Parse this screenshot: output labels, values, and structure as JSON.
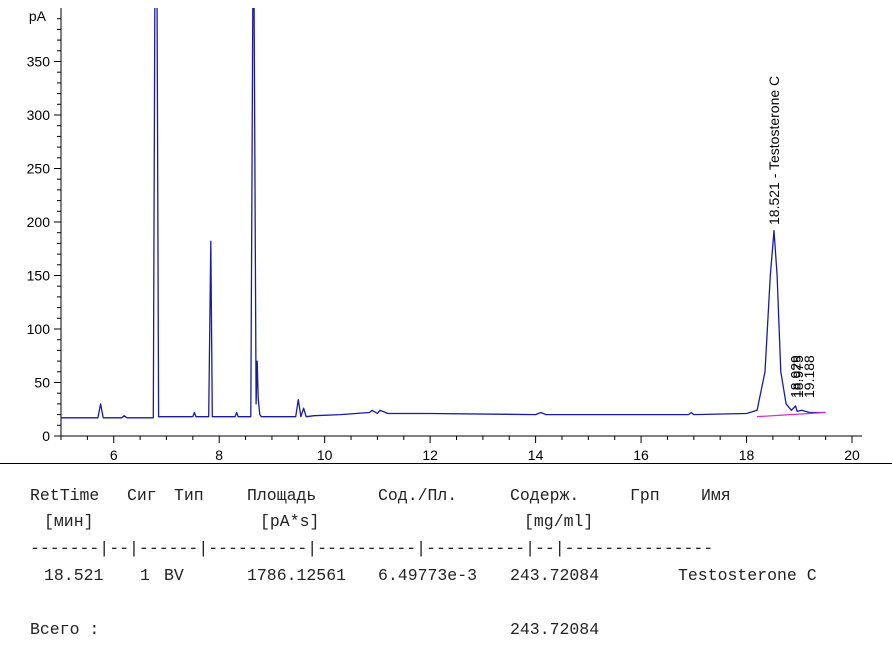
{
  "chart_data": {
    "type": "line",
    "y_unit": "pA",
    "xlim": [
      5,
      20
    ],
    "ylim": [
      0,
      400
    ],
    "x_ticks": [
      6,
      8,
      10,
      12,
      14,
      16,
      18,
      20
    ],
    "y_ticks": [
      0,
      50,
      100,
      150,
      200,
      250,
      300,
      350
    ],
    "series": [
      {
        "color": "#1a1aa8",
        "x": [
          5.0,
          5.7,
          5.75,
          5.8,
          6.15,
          6.2,
          6.25,
          6.75,
          6.78,
          6.8,
          6.82,
          6.85,
          7.5,
          7.53,
          7.56,
          7.8,
          7.84,
          7.87,
          8.3,
          8.33,
          8.36,
          8.6,
          8.64,
          8.66,
          8.7,
          8.72,
          8.74,
          8.77,
          8.8,
          9.45,
          9.5,
          9.55,
          9.6,
          9.65,
          9.8,
          10.3,
          10.85,
          10.9,
          11.0,
          11.05,
          11.2,
          12.0,
          14.0,
          14.1,
          14.2,
          16.0,
          16.9,
          16.95,
          17.0,
          18.0,
          18.2,
          18.35,
          18.45,
          18.521,
          18.58,
          18.65,
          18.75,
          18.85,
          18.93,
          18.96,
          19.05,
          19.19,
          19.5
        ],
        "y": [
          17,
          17,
          30,
          17,
          17,
          19,
          17,
          17,
          420,
          420,
          420,
          18,
          18,
          22,
          18,
          18,
          182,
          18,
          18,
          22,
          18,
          18,
          420,
          420,
          30,
          70,
          35,
          20,
          18,
          18,
          34,
          18,
          26,
          18,
          19,
          20,
          22,
          24,
          21,
          24,
          21,
          21,
          20,
          22,
          20,
          20,
          20,
          22,
          20,
          21,
          24,
          60,
          150,
          192,
          150,
          60,
          30,
          24,
          28,
          23,
          24,
          22,
          22
        ]
      },
      {
        "color": "#cc33cc",
        "x": [
          18.2,
          19.5
        ],
        "y": [
          18,
          22
        ]
      }
    ],
    "peak_labels": [
      "18.521 -  Testosterone C",
      "18.929",
      "18.975",
      "19.188"
    ]
  },
  "report": {
    "headers_1": [
      "RetTime",
      "Сиг",
      "Тип",
      "Площадь",
      "Сод./Пл.",
      "Содерж.",
      "Грп",
      "Имя"
    ],
    "headers_2": [
      "[мин]",
      "[pA*s]",
      "[mg/ml]"
    ],
    "separator": "-------|--|------|----------|----------|----------|--|---------------",
    "row": [
      "18.521",
      "1",
      "BV",
      "1786.12561",
      "6.49773e-3",
      "243.72084",
      "",
      "Testosterone C"
    ],
    "total_label": "Всего :",
    "total_value": "243.72084"
  }
}
